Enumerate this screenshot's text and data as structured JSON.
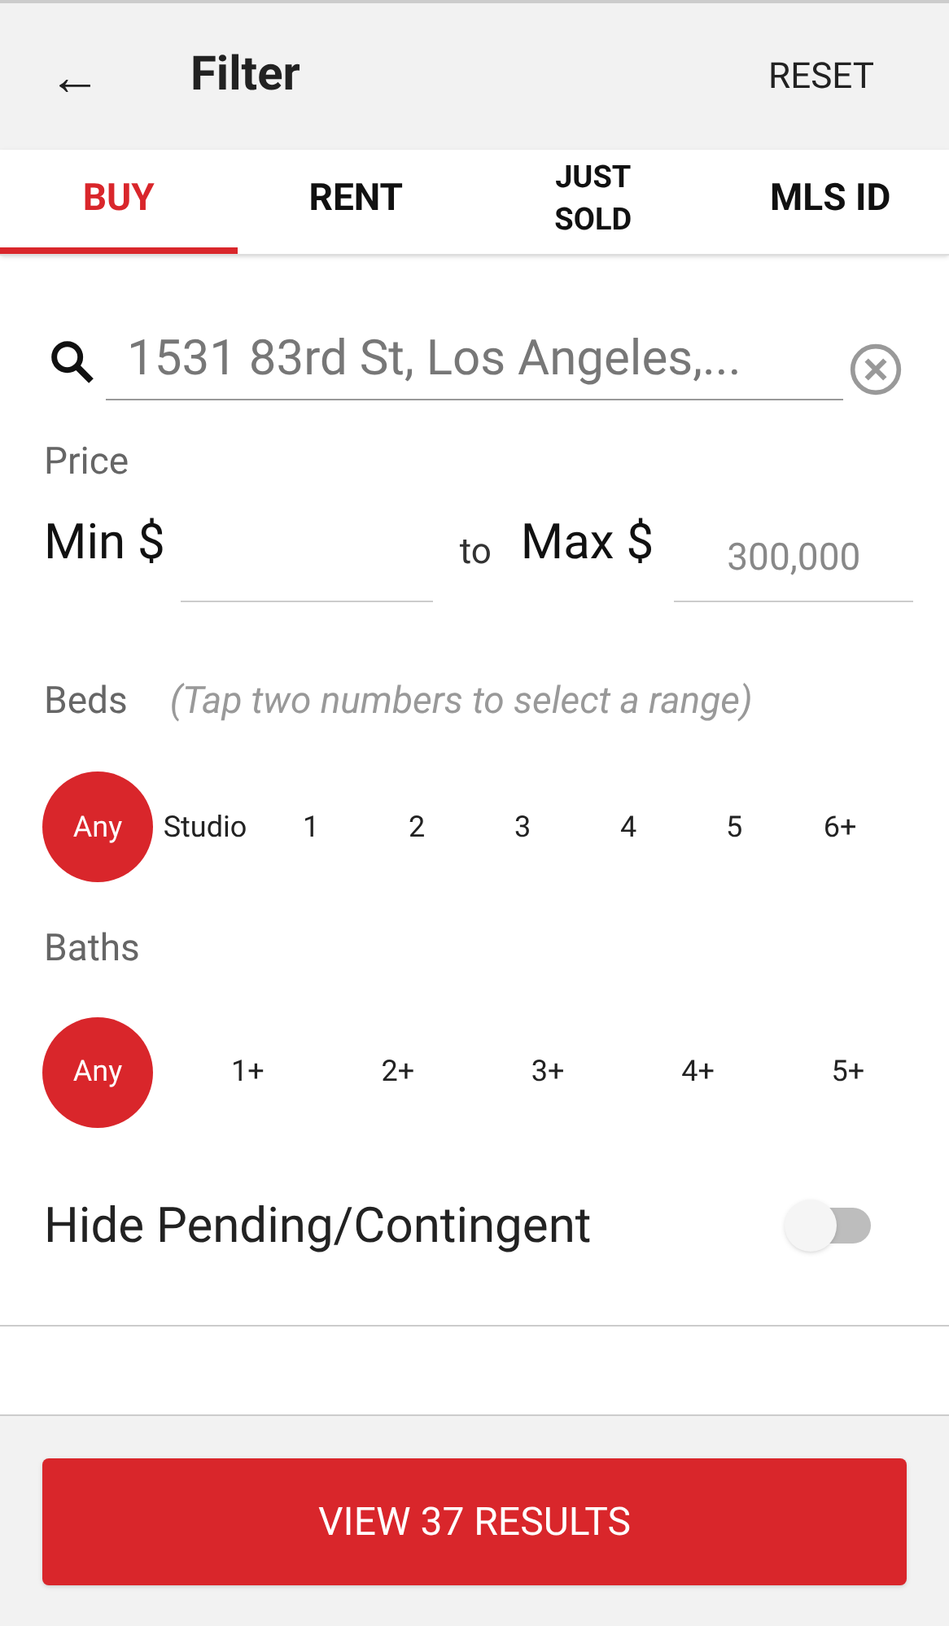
{
  "header": {
    "back": "←",
    "title": "Filter",
    "reset": "RESET"
  },
  "tabs": [
    {
      "label": "BUY",
      "selected": true
    },
    {
      "label": "RENT",
      "selected": false
    },
    {
      "label": "JUST SOLD",
      "selected": false
    },
    {
      "label": "MLS ID",
      "selected": false
    }
  ],
  "search": {
    "value": "1531 83rd St, Los Angeles,..."
  },
  "price": {
    "label": "Price",
    "min_label": "Min $",
    "to": "to",
    "max_label": "Max $",
    "max_placeholder": "300,000"
  },
  "beds": {
    "label": "Beds",
    "hint": "(Tap two numbers to select a range)",
    "options": [
      {
        "label": "Any",
        "selected": true
      },
      {
        "label": "Studio",
        "selected": false
      },
      {
        "label": "1",
        "selected": false
      },
      {
        "label": "2",
        "selected": false
      },
      {
        "label": "3",
        "selected": false
      },
      {
        "label": "4",
        "selected": false
      },
      {
        "label": "5",
        "selected": false
      },
      {
        "label": "6+",
        "selected": false
      }
    ]
  },
  "baths": {
    "label": "Baths",
    "options": [
      {
        "label": "Any",
        "selected": true
      },
      {
        "label": "1+",
        "selected": false
      },
      {
        "label": "2+",
        "selected": false
      },
      {
        "label": "3+",
        "selected": false
      },
      {
        "label": "4+",
        "selected": false
      },
      {
        "label": "5+",
        "selected": false
      }
    ]
  },
  "hide_pending": {
    "label": "Hide Pending/Contingent",
    "on": false
  },
  "footer": {
    "button": "VIEW 37 RESULTS"
  }
}
